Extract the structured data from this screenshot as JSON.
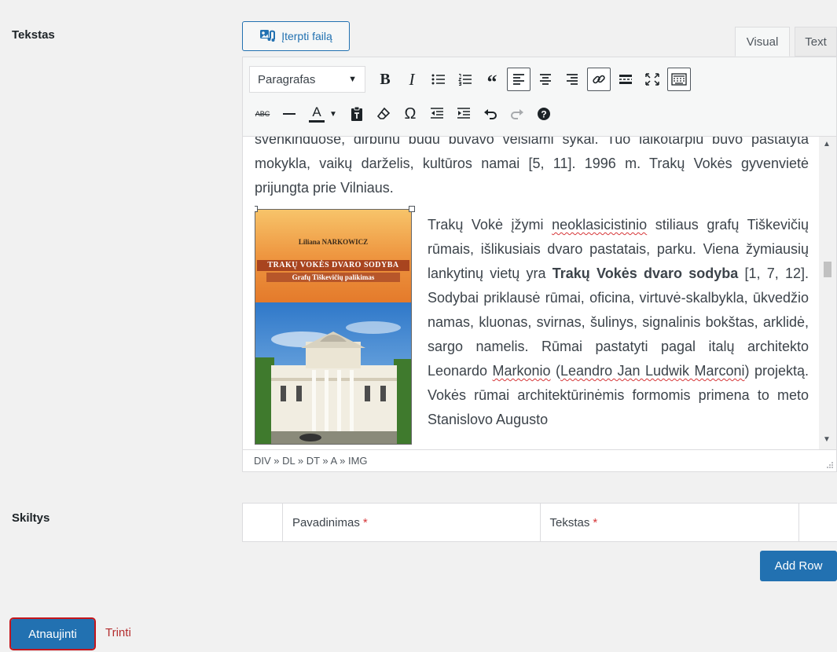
{
  "fields": {
    "text_label": "Tekstas",
    "columns_label": "Skiltys"
  },
  "media_button": {
    "label": "Įterpti failą",
    "icon": "media-add-icon"
  },
  "editor_tabs": [
    {
      "label": "Visual",
      "active": true
    },
    {
      "label": "Text",
      "active": false
    }
  ],
  "toolbar": {
    "format_select": "Paragrafas",
    "row1_icons": [
      "bold-icon",
      "italic-icon",
      "bullet-list-icon",
      "numbered-list-icon",
      "blockquote-icon",
      "align-left-icon",
      "align-center-icon",
      "align-right-icon",
      "link-icon",
      "read-more-icon",
      "fullscreen-icon",
      "toolbar-toggle-icon"
    ],
    "row2_icons": [
      "strikethrough-icon",
      "horizontal-line-icon",
      "text-color-icon",
      "paste-text-icon",
      "clear-formatting-icon",
      "special-character-icon",
      "outdent-icon",
      "indent-icon",
      "undo-icon",
      "redo-icon",
      "help-icon"
    ],
    "strike_label": "ABC",
    "color_label": "A"
  },
  "content": {
    "p1": "švenkinduose, dirbtinu būdu buvavo veisiami sykai. Tuo laikotarpiu buvo pastatyta mokykla, vaikų darželis, kultūros namai [5, 11]. 1996 m. Trakų Vokės gyvenvietė prijungta prie Vilniaus.",
    "p2_a": "Trakų Vokė įžymi ",
    "p2_sp1": "neoklasicistinio",
    "p2_b": " stiliaus grafų Tiškevičių rūmais, išlikusiais dvaro pastatais, parku. Viena žymiausių lankytinų vietų yra ",
    "p2_bold": "Trakų Vokės dvaro sodyba",
    "p2_c": " [1, 7, 12]. Sodybai priklausė rūmai, oficina, virtuvė-skalbykla, ūkvedžio namas, kluonas, svirnas, šulinys, signalinis bokštas, arklidė, sargo namelis. Rūmai pastatyti pagal italų architekto Leonardo ",
    "p2_sp2": "Markonio",
    "p2_d": " (",
    "p2_sp3": "Leandro Jan Ludwik Marconi",
    "p2_e": ") projektą. Vokės rūmai architektūrinėmis formomis primena to meto Stanislovo Augusto"
  },
  "book": {
    "author": "Liliana NARKOWICZ",
    "title": "TRAKŲ VOKĖS DVARO SODYBA",
    "subtitle": "Grafų Tiškevičių palikimas"
  },
  "statusbar": {
    "path": "DIV » DL » DT » A » IMG"
  },
  "repeater": {
    "col1": "Pavadinimas",
    "col2": "Tekstas",
    "required_mark": "*",
    "add_row": "Add Row"
  },
  "actions": {
    "update": "Atnaujinti",
    "delete": "Trinti"
  },
  "colors": {
    "primary": "#2271b1",
    "danger": "#b32d2e",
    "highlight": "#c4161c"
  }
}
